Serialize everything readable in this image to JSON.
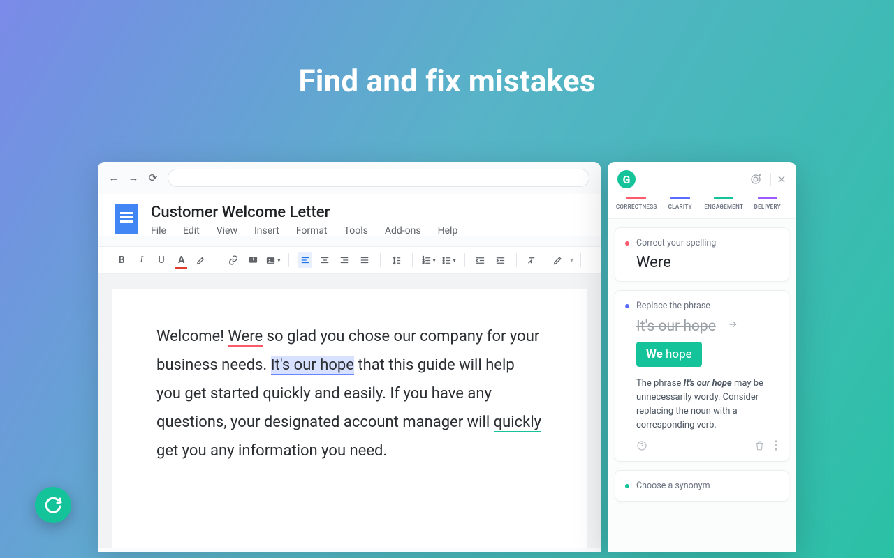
{
  "hero": {
    "headline": "Find and fix mistakes"
  },
  "browser": {
    "doc_title": "Customer Welcome Letter",
    "menu": [
      "File",
      "Edit",
      "View",
      "Insert",
      "Format",
      "Tools",
      "Add-ons",
      "Help"
    ]
  },
  "document": {
    "pre1": "Welcome! ",
    "err_were": "Were",
    "post1": " so glad you chose our company for your business needs. ",
    "err_hope": "It's our hope",
    "post2": " that this guide will help you get started quickly and easily. If you have any questions, your designated account manager will ",
    "err_quickly": "quickly",
    "post3": " get you any information you need."
  },
  "panel": {
    "categories": [
      {
        "label": "CORRECTNESS",
        "color": "#ff5a6b"
      },
      {
        "label": "CLARITY",
        "color": "#5b6bff"
      },
      {
        "label": "ENGAGEMENT",
        "color": "#15c39a"
      },
      {
        "label": "DELIVERY",
        "color": "#9b5cff"
      }
    ],
    "card_spelling": {
      "dot_color": "#ff5a6b",
      "label": "Correct your spelling",
      "word": "Were"
    },
    "card_phrase": {
      "dot_color": "#5b6bff",
      "label": "Replace the phrase",
      "strike": "It's our hope",
      "pill_bold": "We",
      "pill_rest": " hope",
      "explain_pre": "The phrase ",
      "explain_b": "It's our hope",
      "explain_post": " may be unnecessarily wordy. Consider replacing the noun with a corresponding verb."
    },
    "card_synonym": {
      "dot_color": "#15c39a",
      "label": "Choose a synonym"
    }
  }
}
